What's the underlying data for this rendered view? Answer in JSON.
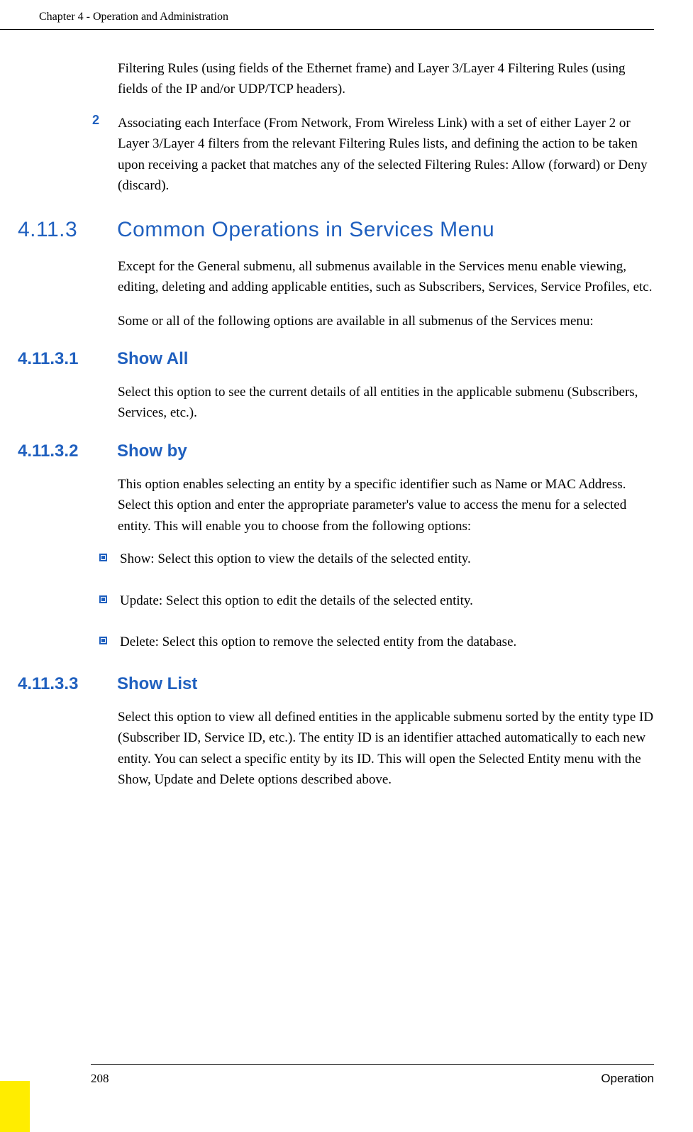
{
  "header": {
    "chapter": "Chapter 4 - Operation and Administration"
  },
  "body": {
    "intro_continued": "Filtering Rules (using fields of the Ethernet frame) and Layer 3/Layer 4 Filtering Rules (using fields of the IP and/or UDP/TCP headers).",
    "numbered_item": {
      "number": "2",
      "text": "Associating each Interface (From Network, From Wireless Link) with a set of either Layer 2 or Layer 3/Layer 4 filters from the relevant Filtering Rules lists, and defining the action to be taken upon receiving a packet that matches any of the selected Filtering Rules: Allow (forward) or Deny (discard)."
    },
    "section_4_11_3": {
      "number": "4.11.3",
      "title": "Common Operations in Services Menu",
      "para1": "Except for the General submenu, all submenus available in the Services menu enable viewing, editing, deleting and adding applicable entities, such as Subscribers, Services, Service Profiles, etc.",
      "para2": "Some or all of the following options are available in all submenus of the Services menu:"
    },
    "section_4_11_3_1": {
      "number": "4.11.3.1",
      "title": "Show All",
      "para": "Select this option to see the current details of all entities in the applicable submenu (Subscribers, Services, etc.)."
    },
    "section_4_11_3_2": {
      "number": "4.11.3.2",
      "title": "Show by",
      "para": "This option enables selecting an entity by a specific identifier such as Name or MAC Address. Select this option and enter the appropriate parameter's value to access the menu for a selected entity. This will enable you to choose from the following options:",
      "bullets": [
        "Show: Select this option to view the details of the selected entity.",
        "Update: Select this option to edit the details of the selected entity.",
        "Delete: Select this option to remove the selected entity from the database."
      ]
    },
    "section_4_11_3_3": {
      "number": "4.11.3.3",
      "title": "Show List",
      "para": "Select this option to view all defined entities in the applicable submenu sorted by the entity type ID (Subscriber ID, Service ID, etc.). The entity ID is an identifier attached automatically to each new entity. You can select a specific entity by its ID. This will open the Selected Entity menu with the Show, Update and Delete options described above."
    }
  },
  "footer": {
    "page_number": "208",
    "label": "Operation"
  }
}
